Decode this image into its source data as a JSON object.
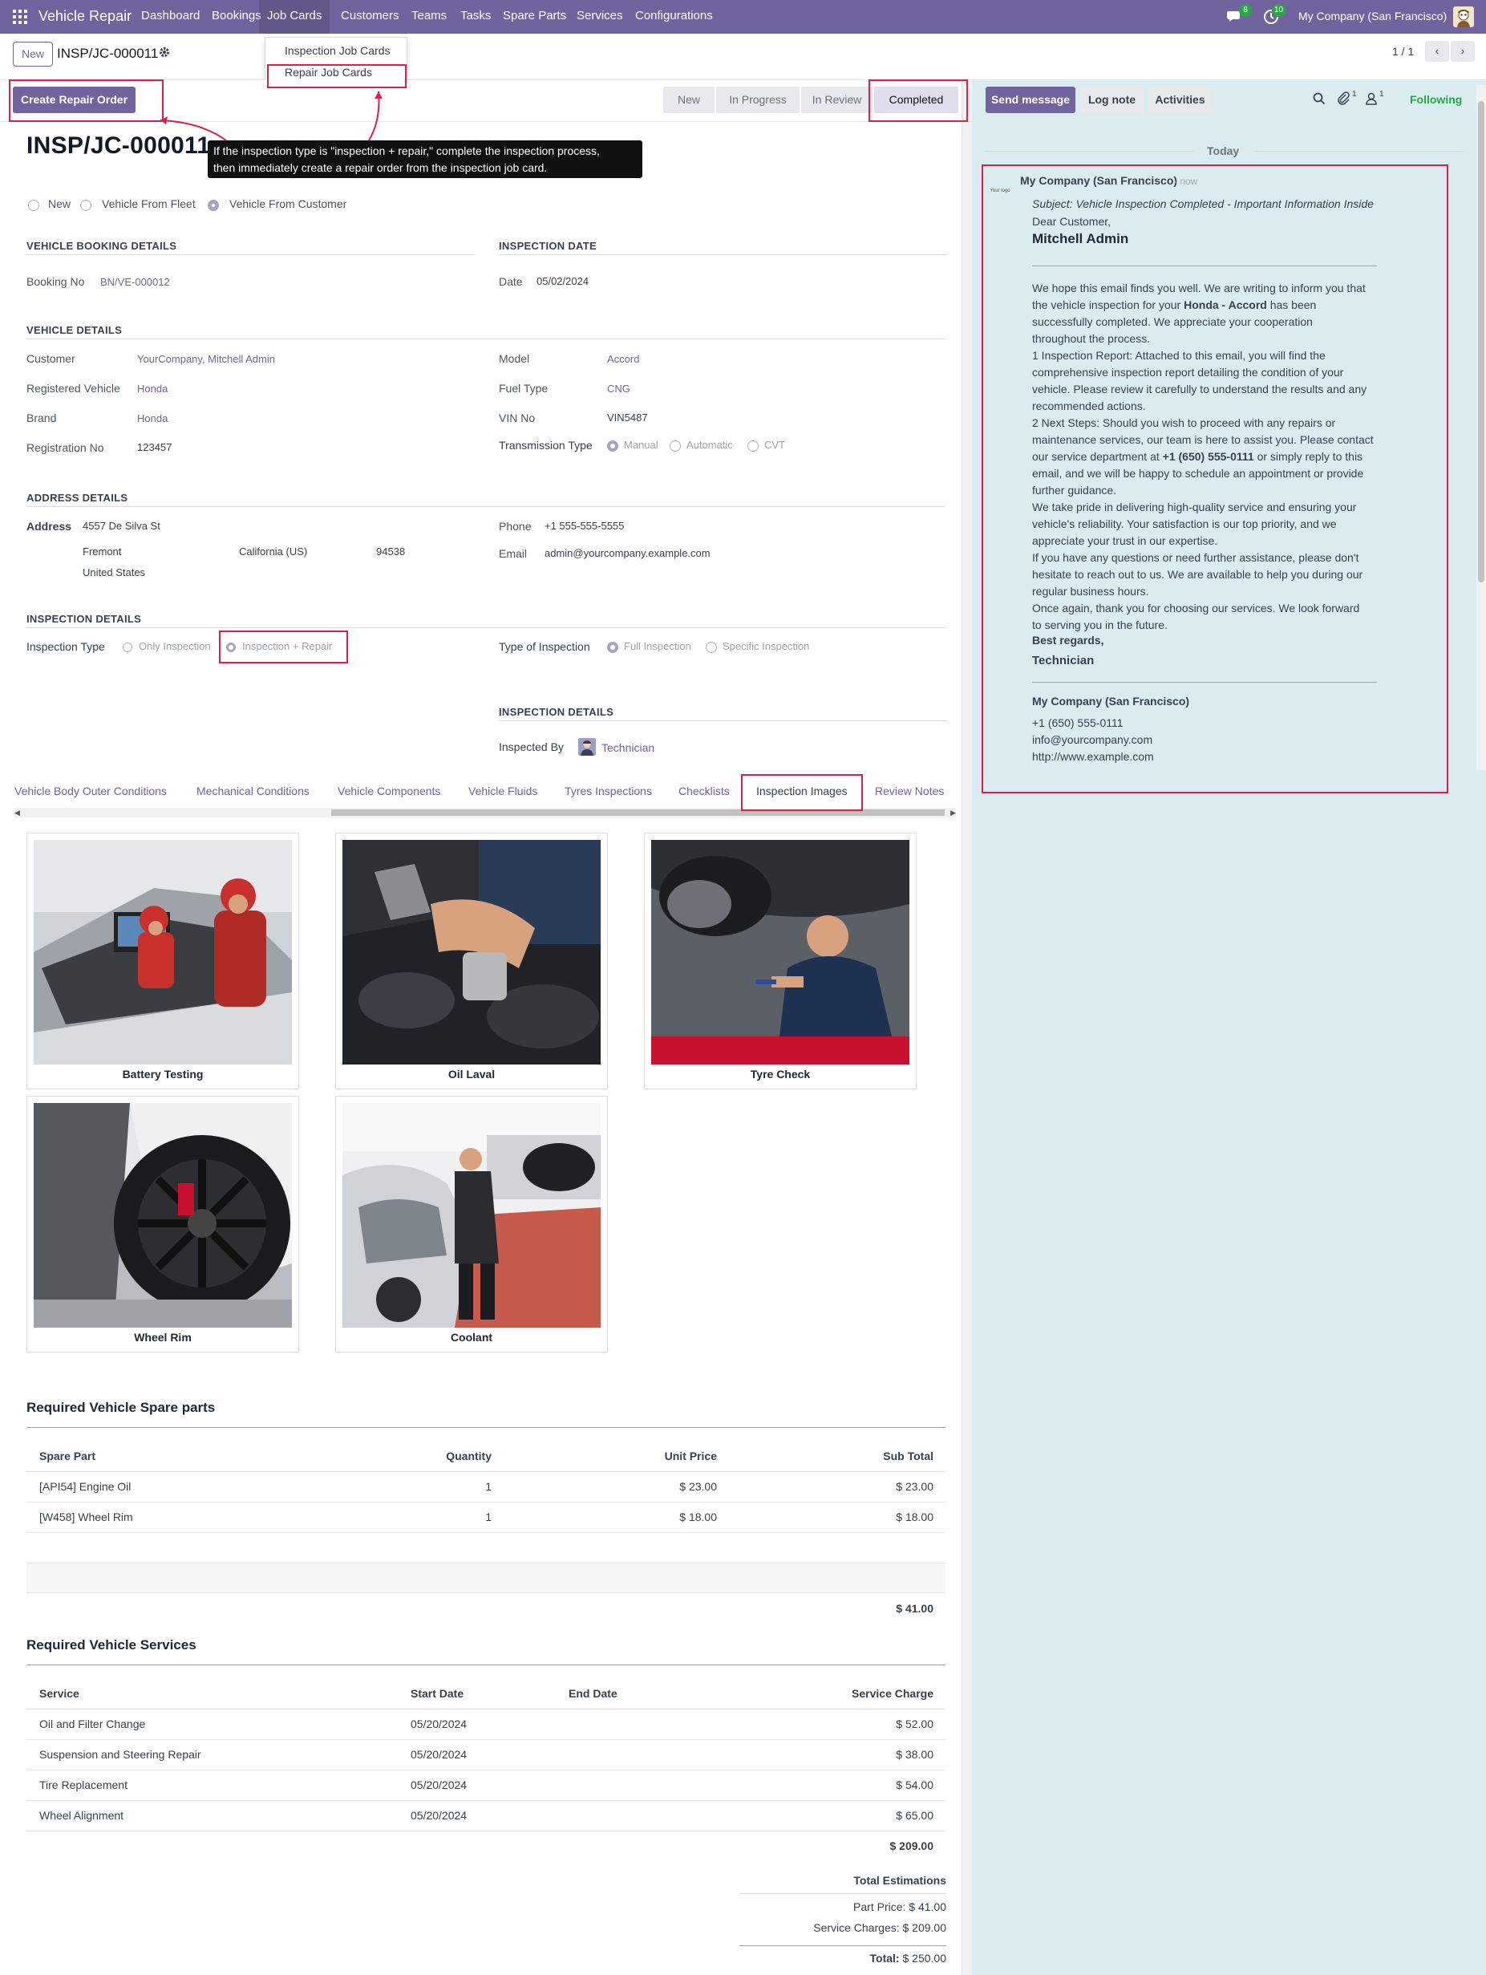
{
  "navbar": {
    "app_name": "Vehicle Repair",
    "menu": [
      "Dashboard",
      "Bookings",
      "Job Cards",
      "Customers",
      "Teams",
      "Tasks",
      "Spare Parts",
      "Services",
      "Configurations"
    ],
    "messages_count": "8",
    "activities_count": "10",
    "company": "My Company (San Francisco)"
  },
  "dropdown": {
    "items": [
      "Inspection Job Cards",
      "Repair Job Cards"
    ]
  },
  "control_panel": {
    "new_label": "New",
    "breadcrumb": "INSP/JC-000011",
    "pager": "1 / 1"
  },
  "statusbar": {
    "create_repair_label": "Create Repair Order",
    "stages": [
      "New",
      "In Progress",
      "In Review",
      "Completed"
    ]
  },
  "tooltip": {
    "line1": "If the inspection type is \"inspection + repair,\" complete the inspection process,",
    "line2": "then immediately create a repair order from the inspection job card."
  },
  "form": {
    "title": "INSP/JC-000011",
    "source_options": [
      "New",
      "Vehicle From Fleet",
      "Vehicle From Customer"
    ],
    "booking": {
      "section": "VEHICLE BOOKING DETAILS",
      "booking_no_label": "Booking No",
      "booking_no": "BN/VE-000012"
    },
    "inspection_date": {
      "section": "INSPECTION DATE",
      "date_label": "Date",
      "date": "05/02/2024"
    },
    "vehicle": {
      "section": "VEHICLE DETAILS",
      "customer_label": "Customer",
      "customer": "YourCompany, Mitchell Admin",
      "registered_label": "Registered Vehicle",
      "registered": "Honda",
      "brand_label": "Brand",
      "brand": "Honda",
      "registration_label": "Registration No",
      "registration": "123457",
      "model_label": "Model",
      "model": "Accord",
      "fuel_label": "Fuel Type",
      "fuel": "CNG",
      "vin_label": "VIN No",
      "vin": "VIN5487",
      "transmission_label": "Transmission Type",
      "transmission_options": [
        "Manual",
        "Automatic",
        "CVT"
      ]
    },
    "address": {
      "section": "ADDRESS DETAILS",
      "address_label": "Address",
      "street": "4557 De Silva St",
      "city": "Fremont",
      "state": "California (US)",
      "zip": "94538",
      "country": "United States",
      "phone_label": "Phone",
      "phone": "+1 555-555-5555",
      "email_label": "Email",
      "email": "admin@yourcompany.example.com"
    },
    "inspection": {
      "section": "INSPECTION DETAILS",
      "type_label": "Inspection Type",
      "type_options": [
        "Only Inspection",
        "Inspection + Repair"
      ],
      "kind_label": "Type of Inspection",
      "kind_options": [
        "Full Inspection",
        "Specific Inspection"
      ],
      "section2": "INSPECTION DETAILS",
      "inspected_by_label": "Inspected By",
      "inspected_by": "Technician"
    },
    "tabs": [
      "Vehicle Body Outer Conditions",
      "Mechanical Conditions",
      "Vehicle Components",
      "Vehicle Fluids",
      "Tyres Inspections",
      "Checklists",
      "Inspection Images",
      "Review Notes"
    ],
    "images": [
      "Battery Testing",
      "Oil Laval",
      "Tyre Check",
      "Wheel Rim",
      "Coolant"
    ]
  },
  "spare_parts": {
    "title": "Required Vehicle Spare parts",
    "headers": [
      "Spare Part",
      "Quantity",
      "Unit Price",
      "Sub Total"
    ],
    "rows": [
      [
        "[API54] Engine Oil",
        "1",
        "$ 23.00",
        "$ 23.00"
      ],
      [
        "[W458] Wheel Rim",
        "1",
        "$ 18.00",
        "$ 18.00"
      ]
    ],
    "total": "$ 41.00"
  },
  "services": {
    "title": "Required Vehicle Services",
    "headers": [
      "Service",
      "Start Date",
      "End Date",
      "Service Charge"
    ],
    "rows": [
      [
        "Oil and Filter Change",
        "05/20/2024",
        "",
        "$ 52.00"
      ],
      [
        "Suspension and Steering Repair",
        "05/20/2024",
        "",
        "$ 38.00"
      ],
      [
        "Tire Replacement",
        "05/20/2024",
        "",
        "$ 54.00"
      ],
      [
        "Wheel Alignment",
        "05/20/2024",
        "",
        "$ 65.00"
      ]
    ],
    "total": "$ 209.00"
  },
  "totals": {
    "title": "Total Estimations",
    "part_price": "Part Price: $ 41.00",
    "service_charges": "Service Charges: $ 209.00",
    "total_label": "Total:",
    "total": "$ 250.00"
  },
  "chatter": {
    "send_message": "Send message",
    "log_note": "Log note",
    "activities": "Activities",
    "attachments_count": "1",
    "followers_count": "1",
    "following": "Following",
    "date_sep": "Today",
    "author": "My Company (San Francisco)",
    "time": "- now",
    "logo_text": "Your logo",
    "subject": "Subject: Vehicle Inspection Completed - Important Information Inside",
    "greeting": "Dear Customer,",
    "recipient": "Mitchell Admin",
    "p1_a": "We hope this email finds you well. We are writing to inform you that",
    "p1_b": "the vehicle inspection for your",
    "p1_vehicle": "Honda  -  Accord",
    "p1_c": "has been",
    "p1_d": "successfully completed. We appreciate your cooperation",
    "p1_e": "throughout the process.",
    "p2_a": "1 Inspection Report: Attached to this email, you will find the",
    "p2_b": "comprehensive inspection report detailing the condition of your",
    "p2_c": "vehicle. Please review it carefully to understand the results and any",
    "p2_d": "recommended actions.",
    "p3_a": "2 Next Steps: Should you wish to proceed with any repairs or",
    "p3_b": "maintenance services, our team is here to assist you. Please contact",
    "p3_c": "our service department at",
    "p3_phone": "+1 (650) 555-0111",
    "p3_d": "or simply reply to this",
    "p3_e": "email, and we will be happy to schedule an appointment or provide",
    "p3_f": "further guidance.",
    "p4_a": "We take pride in delivering high-quality service and ensuring your",
    "p4_b": "vehicle's reliability. Your satisfaction is our top priority, and we",
    "p4_c": "appreciate your trust in our expertise.",
    "p5_a": "If you have any questions or need further assistance, please don't",
    "p5_b": "hesitate to reach out to us. We are available to help you during our",
    "p5_c": "regular business hours.",
    "p6_a": "Once again, thank you for choosing our services. We look forward",
    "p6_b": "to serving you in the future.",
    "regards": "Best regards,",
    "signer": "Technician",
    "company": "My Company (San Francisco)",
    "company_phone": "+1 (650) 555-0111",
    "company_email": "info@yourcompany.com",
    "company_web": "http://www.example.com"
  }
}
